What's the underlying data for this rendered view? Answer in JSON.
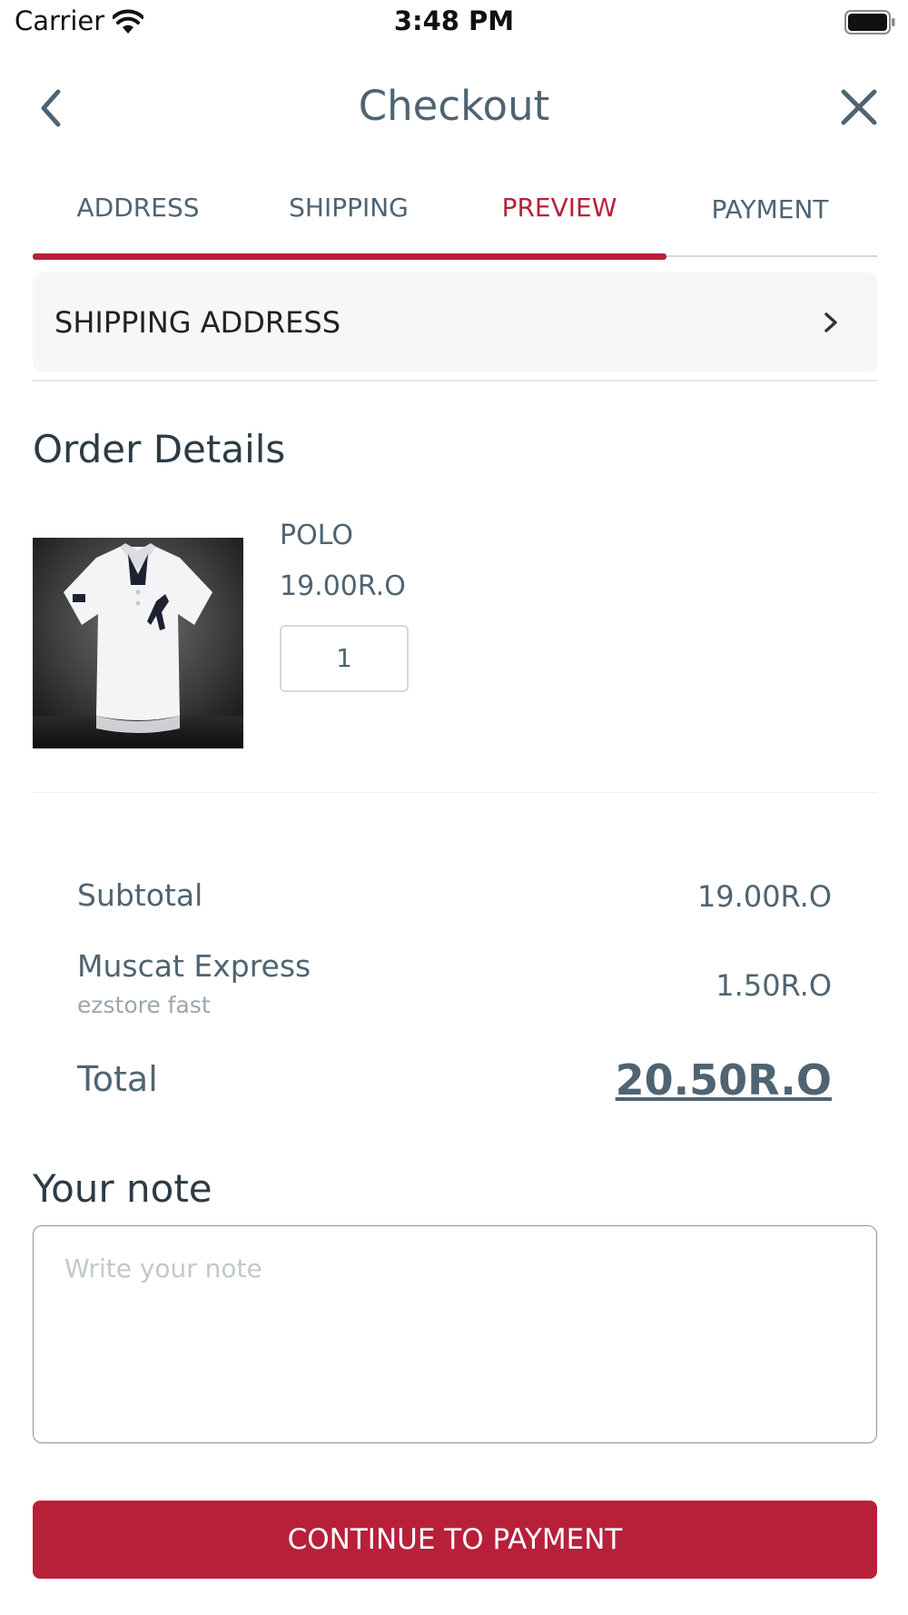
{
  "status_bar": {
    "carrier": "Carrier",
    "time": "3:48 PM"
  },
  "nav": {
    "title": "Checkout",
    "back_icon": "chevron-left-icon",
    "close_icon": "close-icon"
  },
  "tabs": [
    {
      "label": "ADDRESS"
    },
    {
      "label": "SHIPPING"
    },
    {
      "label": "PREVIEW",
      "active": true
    },
    {
      "label": "PAYMENT"
    }
  ],
  "progress": {
    "completed_steps": 3,
    "total_steps": 4
  },
  "shipping_address": {
    "label": "SHIPPING ADDRESS",
    "icon": "chevron-right-icon"
  },
  "order": {
    "heading": "Order Details",
    "items": [
      {
        "name": "POLO",
        "price": "19.00R.O",
        "quantity": "1"
      }
    ]
  },
  "summary": {
    "subtotal_label": "Subtotal",
    "subtotal_value": "19.00R.O",
    "shipping_label": "Muscat Express",
    "shipping_sublabel": "ezstore fast",
    "shipping_value": "1.50R.O",
    "total_label": "Total",
    "total_value": "20.50R.O"
  },
  "note": {
    "heading": "Your note",
    "placeholder": "Write your note",
    "value": ""
  },
  "cta": {
    "label": "CONTINUE TO PAYMENT"
  },
  "colors": {
    "accent": "#b8203a",
    "text": "#4f6472",
    "muted": "#9aa6ae"
  }
}
